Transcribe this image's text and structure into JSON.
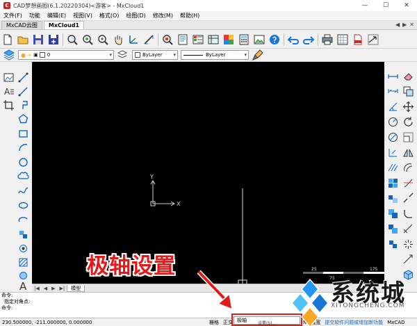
{
  "window": {
    "title": "CAD梦想画图(6.1.20220304)<游客> - MxCloud1",
    "minimize": "—",
    "maximize": "☐",
    "close": "✕"
  },
  "menu": [
    "文件(F)",
    "功能",
    "编辑(E)",
    "视图(V)",
    "格式(O)",
    "绘图(D)",
    "修改(M)",
    "帮助(H)"
  ],
  "tabs": {
    "items": [
      "MxCAD云图",
      "MxCloud1"
    ],
    "active_index": 1,
    "controls": [
      "◀",
      "▶",
      "✕"
    ]
  },
  "properties": {
    "layer_value": "0",
    "color_value": "ByLayer",
    "linetype_value": "ByLayer"
  },
  "canvas": {
    "ucs_x_label": "X",
    "ucs_y_label": "Y",
    "scale_labels": [
      "25",
      "75",
      "175"
    ],
    "background": "#000000"
  },
  "model_tabs": {
    "nav": [
      "|◀",
      "◀",
      "▶",
      "▶|"
    ],
    "active": "模型"
  },
  "command": {
    "lines": [
      "命令:",
      "指定对角点:",
      "命令:"
    ]
  },
  "status": {
    "coords": "230.500000, -211.000000, 0.000000",
    "items": [
      "栅格",
      "正交",
      "极轴",
      "N",
      "线宽",
      "提交软件问题或增加新功能",
      "MxCAD"
    ],
    "popup_item": "极轴",
    "popup_sub": "设置(S)..."
  },
  "overlay": {
    "callout": "极轴设置",
    "watermark_text": "系统城",
    "watermark_url": "XITONGCHENG.COM"
  },
  "colors": {
    "accent_red": "#e21a1a",
    "canvas_bg": "#000000",
    "logo_blue": "#1976d2"
  }
}
